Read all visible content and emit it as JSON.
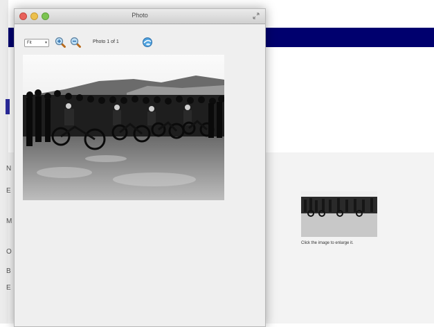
{
  "window": {
    "title": "Photo"
  },
  "toolbar": {
    "zoom_value": "Fit",
    "photo_count": "Photo  1 of  1",
    "icons": [
      "zoom-in-icon",
      "zoom-out-icon",
      "export-icon"
    ]
  },
  "background": {
    "thumbnail_caption": "Click the image to enlarge it.",
    "nav_color": "#00006e",
    "side_letters": [
      "N",
      "E",
      "M",
      "O",
      "B",
      "E"
    ]
  },
  "photo": {
    "description_icon": "photo-image"
  }
}
